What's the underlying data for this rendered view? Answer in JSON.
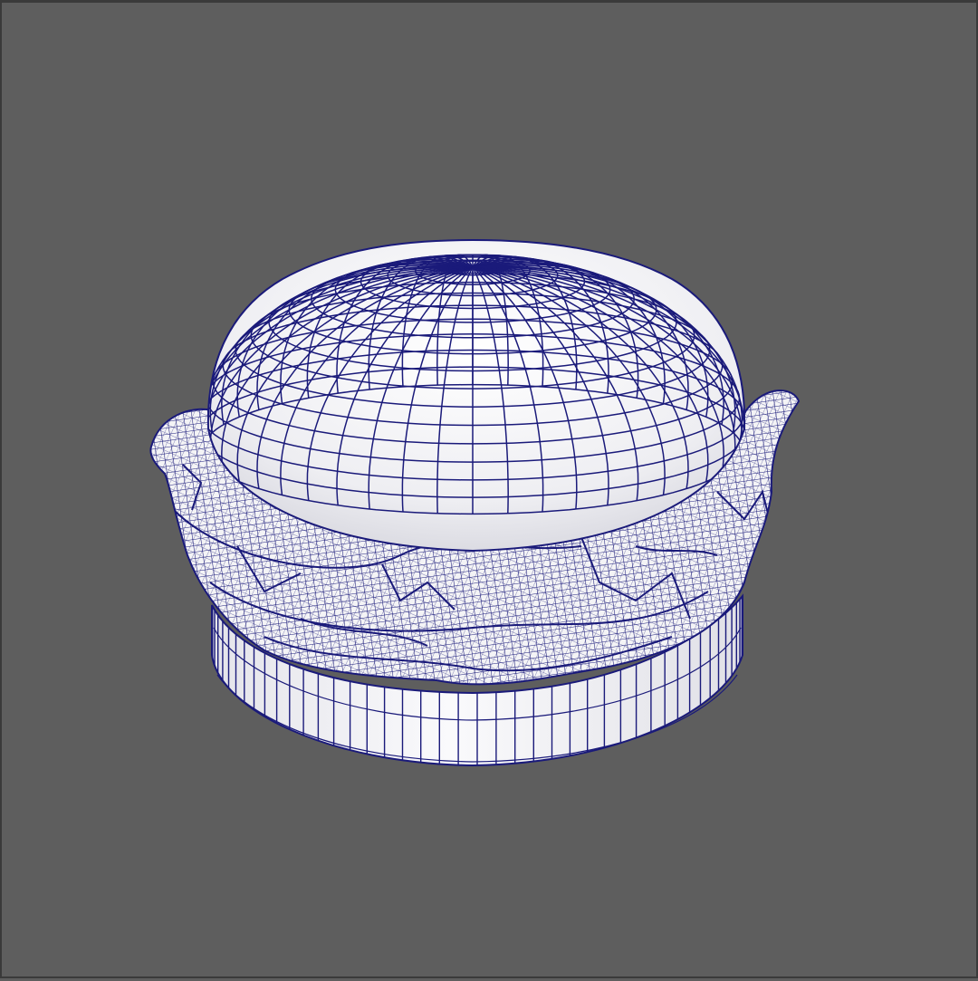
{
  "viewport": {
    "background_color": "#5e5e5e",
    "frame_color": "#3a3a3a"
  },
  "model": {
    "subject": "hamburger",
    "display_mode": "wireframe-on-shaded",
    "wire_color": "#1a1a7a",
    "surface_color": "#f2f2f4",
    "parts": [
      "top-bun",
      "lettuce",
      "patty",
      "bottom-bun"
    ]
  }
}
